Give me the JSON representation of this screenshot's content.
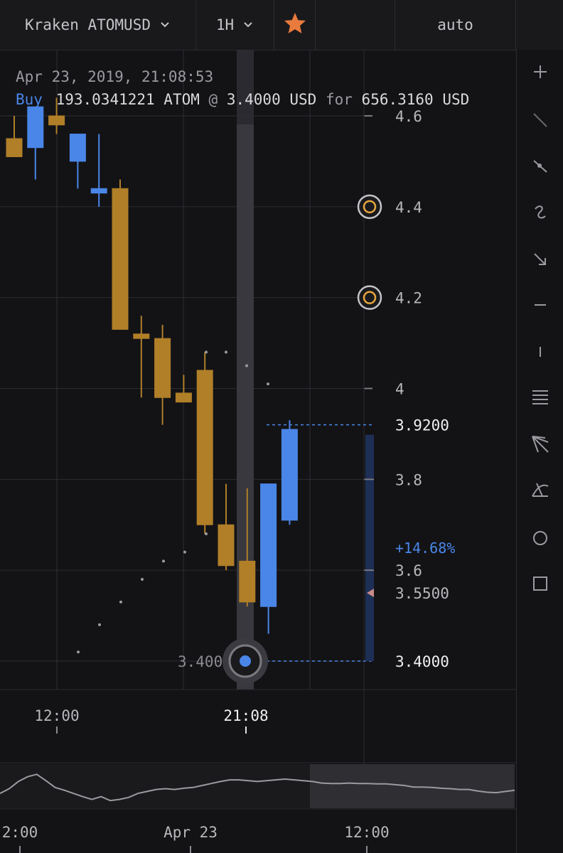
{
  "header": {
    "market_label": "Kraken ATOMUSD",
    "interval_label": "1H",
    "favorite_icon": "star-icon",
    "scale_label": "auto"
  },
  "trade_info": {
    "date": "Apr 23, 2019, 21:08:53",
    "side": "Buy",
    "amount": "193.0341221 ATOM",
    "at_symbol": "@",
    "price": "3.4000 USD",
    "for_word": "for",
    "total": "656.3160 USD"
  },
  "toolbar": {
    "tools": [
      "plus-icon",
      "line-tool-icon",
      "ray-tool-icon",
      "curve-tool-icon",
      "arrow-tool-icon",
      "horizontal-line-icon",
      "vertical-line-icon",
      "parallel-lines-icon",
      "fan-tool-icon",
      "fib-fan-icon",
      "circle-tool-icon",
      "rectangle-tool-icon"
    ]
  },
  "colors": {
    "bull": "#4a86e8",
    "bear": "#b07f28",
    "accent": "#e87b3d",
    "marker": "#e8a63d"
  },
  "chart_data": {
    "type": "candlestick",
    "symbol": "ATOMUSD",
    "exchange": "Kraken",
    "interval": "1H",
    "y_ticks": [
      4.6,
      4.4,
      4.2,
      4,
      3.8,
      3.6
    ],
    "y_tick_labels": [
      "4.6",
      "4.4",
      "4.2",
      "4",
      "3.8",
      "3.6"
    ],
    "ylim": [
      3.335,
      4.66
    ],
    "x_tick_labels": [
      "12:00",
      "21:08"
    ],
    "candles": [
      {
        "o": 4.55,
        "h": 4.6,
        "l": 4.51,
        "c": 4.51
      },
      {
        "o": 4.53,
        "h": 4.62,
        "l": 4.46,
        "c": 4.62
      },
      {
        "o": 4.6,
        "h": 4.64,
        "l": 4.56,
        "c": 4.58
      },
      {
        "o": 4.5,
        "h": 4.56,
        "l": 4.44,
        "c": 4.56
      },
      {
        "o": 4.43,
        "h": 4.56,
        "l": 4.4,
        "c": 4.44
      },
      {
        "o": 4.44,
        "h": 4.46,
        "l": 4.13,
        "c": 4.13
      },
      {
        "o": 4.12,
        "h": 4.16,
        "l": 3.98,
        "c": 4.11
      },
      {
        "o": 4.11,
        "h": 4.14,
        "l": 3.92,
        "c": 3.98
      },
      {
        "o": 3.99,
        "h": 4.03,
        "l": 3.98,
        "c": 3.97
      },
      {
        "o": 4.04,
        "h": 4.08,
        "l": 3.68,
        "c": 3.7
      },
      {
        "o": 3.7,
        "h": 3.79,
        "l": 3.6,
        "c": 3.61
      },
      {
        "o": 3.62,
        "h": 3.78,
        "l": 3.52,
        "c": 3.53
      },
      {
        "o": 3.52,
        "h": 3.79,
        "l": 3.46,
        "c": 3.79
      },
      {
        "o": 3.71,
        "h": 3.93,
        "l": 3.7,
        "c": 3.91
      }
    ],
    "indicator_dots": [
      3.42,
      3.48,
      3.53,
      3.58,
      3.62,
      3.64,
      3.68,
      4.08,
      4.08,
      4.05,
      4.01
    ],
    "trade_marker": {
      "price": 3.4,
      "label": "3.400"
    },
    "price_labels": [
      {
        "value": 3.92,
        "label": "3.9200"
      },
      {
        "value": 3.55,
        "label": "3.5500"
      },
      {
        "value": 3.4,
        "label": "3.4000"
      }
    ],
    "change_label": "+14.68%",
    "alert_levels": [
      4.4,
      4.2
    ],
    "navigator": {
      "x_tick_labels": [
        "2:00",
        "Apr 23",
        "12:00"
      ],
      "series": [
        0.3,
        0.42,
        0.6,
        0.72,
        0.78,
        0.62,
        0.45,
        0.38,
        0.3,
        0.22,
        0.15,
        0.22,
        0.12,
        0.15,
        0.2,
        0.3,
        0.35,
        0.4,
        0.42,
        0.4,
        0.43,
        0.45,
        0.5,
        0.55,
        0.6,
        0.64,
        0.64,
        0.62,
        0.6,
        0.62,
        0.64,
        0.66,
        0.64,
        0.62,
        0.6,
        0.56,
        0.55,
        0.55,
        0.56,
        0.55,
        0.55,
        0.54,
        0.54,
        0.52,
        0.5,
        0.46,
        0.46,
        0.45,
        0.43,
        0.42,
        0.4,
        0.4,
        0.36,
        0.33,
        0.32,
        0.35,
        0.38
      ]
    }
  }
}
